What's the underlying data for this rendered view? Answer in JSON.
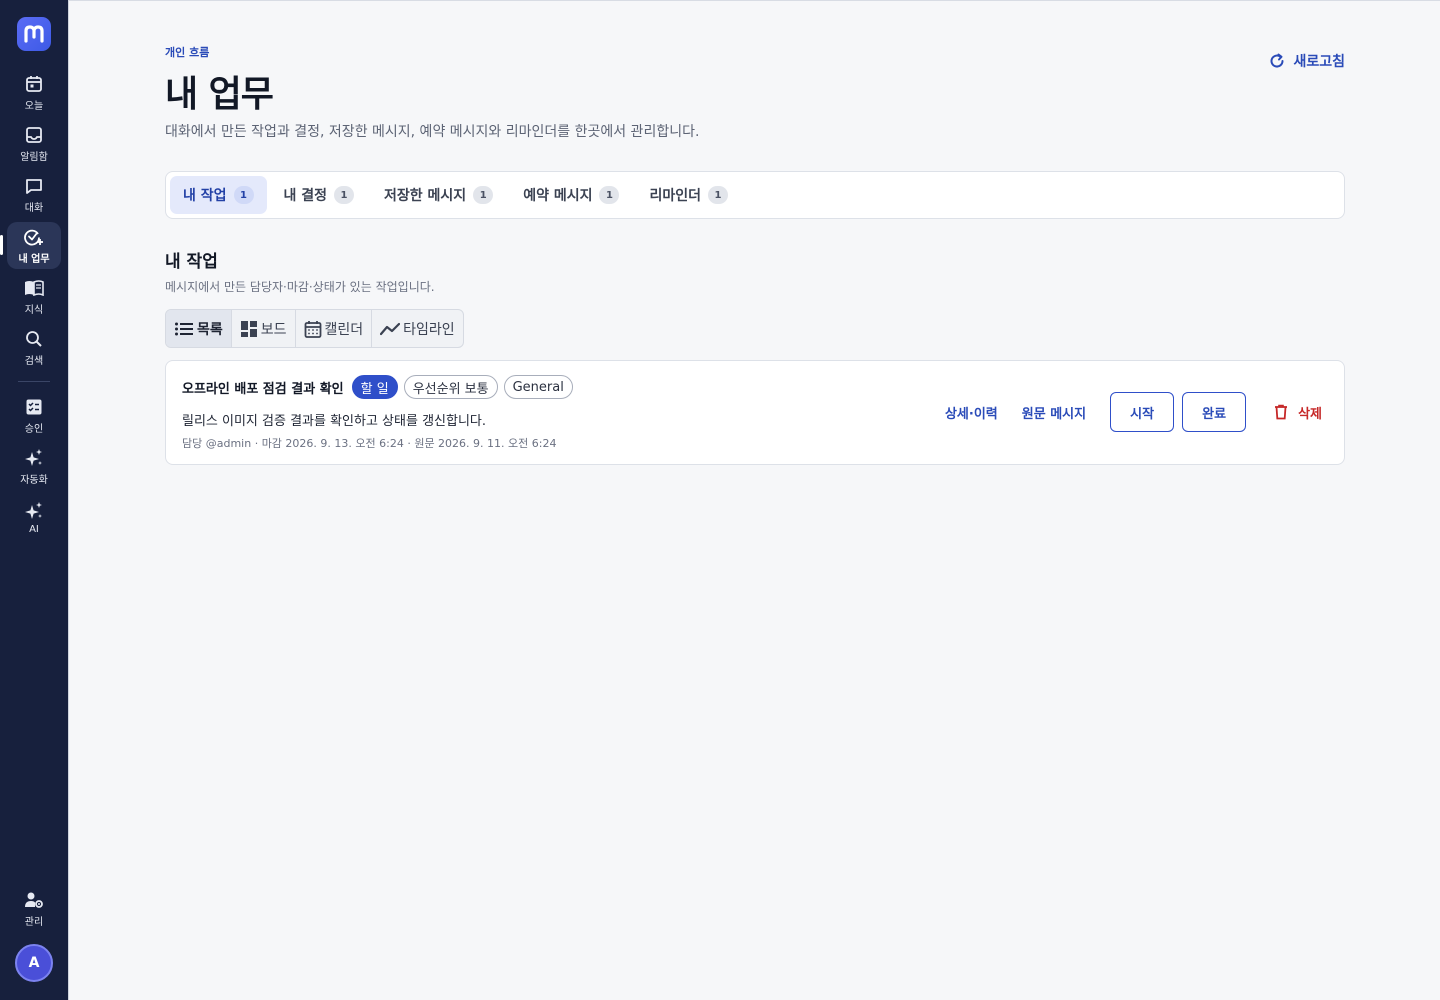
{
  "sidebar": {
    "logo_icon": "m-logo-icon",
    "items": [
      {
        "label": "오늘",
        "icon": "calendar-icon"
      },
      {
        "label": "알림함",
        "icon": "inbox-icon"
      },
      {
        "label": "대화",
        "icon": "chat-icon"
      },
      {
        "label": "내 업무",
        "icon": "check-circle-plus-icon",
        "active": true
      },
      {
        "label": "지식",
        "icon": "book-icon"
      },
      {
        "label": "검색",
        "icon": "search-icon"
      },
      {
        "label": "승인",
        "icon": "checklist-icon"
      },
      {
        "label": "자동화",
        "icon": "sparkle-icon"
      },
      {
        "label": "AI",
        "icon": "sparkle-icon"
      }
    ],
    "admin_label": "관리",
    "avatar_initial": "A"
  },
  "header": {
    "eyebrow": "개인 흐름",
    "title": "내 업무",
    "subtitle": "대화에서 만든 작업과 결정, 저장한 메시지, 예약 메시지와 리마인더를 한곳에서 관리합니다.",
    "refresh_label": "새로고침"
  },
  "tabs": [
    {
      "label": "내 작업",
      "count": "1",
      "active": true
    },
    {
      "label": "내 결정",
      "count": "1"
    },
    {
      "label": "저장한 메시지",
      "count": "1"
    },
    {
      "label": "예약 메시지",
      "count": "1"
    },
    {
      "label": "리마인더",
      "count": "1"
    }
  ],
  "section": {
    "title": "내 작업",
    "subtitle": "메시지에서 만든 담당자·마감·상태가 있는 작업입니다."
  },
  "views": [
    {
      "label": "목록",
      "icon": "list-icon",
      "active": true
    },
    {
      "label": "보드",
      "icon": "board-icon"
    },
    {
      "label": "캘린더",
      "icon": "calendar-icon"
    },
    {
      "label": "타임라인",
      "icon": "timeline-icon"
    }
  ],
  "task": {
    "title": "오프라인 배포 점검 결과 확인",
    "status": "할 일",
    "priority": "우선순위 보통",
    "channel": "General",
    "description": "릴리스 이미지 검증 결과를 확인하고 상태를 갱신합니다.",
    "meta": "담당 @admin · 마감 2026. 9. 13. 오전 6:24 · 원문 2026. 9. 11. 오전 6:24",
    "actions": {
      "detail": "상세·이력",
      "source": "원문 메시지",
      "start": "시작",
      "complete": "완료",
      "delete": "삭제"
    }
  },
  "colors": {
    "sidebar_bg": "#17203d",
    "accent": "#2f4fc9",
    "danger": "#c62828",
    "page_bg": "#f6f7f9"
  }
}
